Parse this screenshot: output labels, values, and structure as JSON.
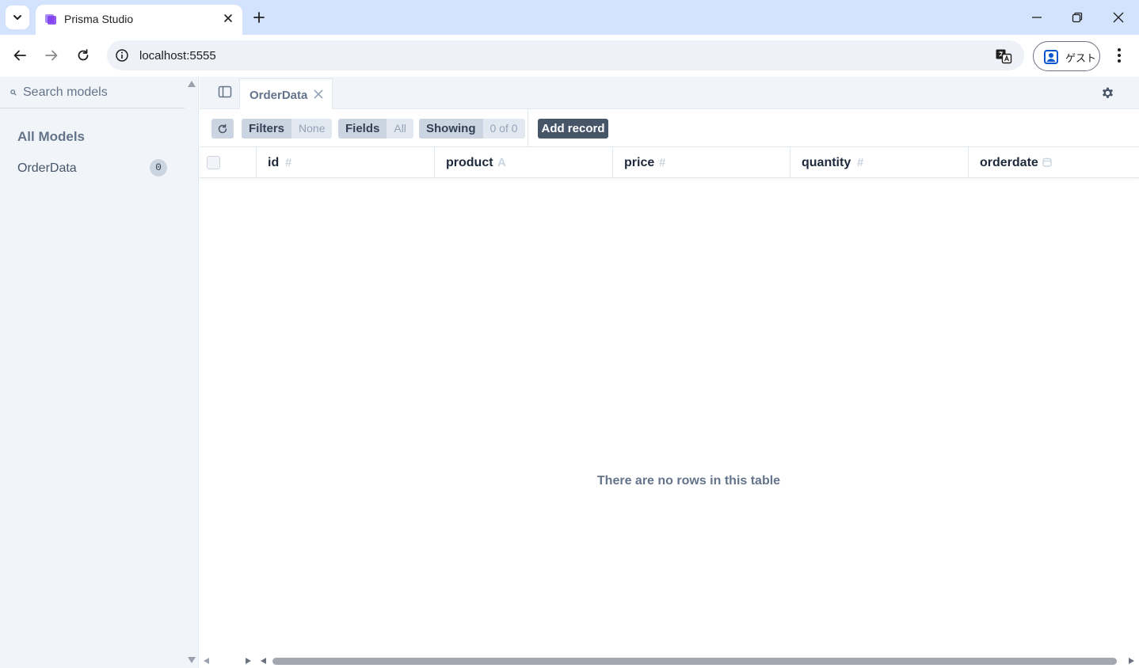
{
  "browser": {
    "tab_title": "Prisma Studio",
    "url": "localhost:5555",
    "profile_label": "ゲスト"
  },
  "sidebar": {
    "search_placeholder": "Search models",
    "heading": "All Models",
    "models": [
      {
        "name": "OrderData",
        "count": "0"
      }
    ]
  },
  "app_tab": {
    "label": "OrderData"
  },
  "actions": {
    "filters_label": "Filters",
    "filters_value": "None",
    "fields_label": "Fields",
    "fields_value": "All",
    "showing_label": "Showing",
    "showing_value": "0 of 0",
    "add_record_label": "Add record"
  },
  "table": {
    "columns": [
      {
        "name": "id",
        "type_glyph": "#"
      },
      {
        "name": "product",
        "type_glyph": "A"
      },
      {
        "name": "price",
        "type_glyph": "#"
      },
      {
        "name": "quantity",
        "type_glyph": "#"
      },
      {
        "name": "orderdate",
        "type_glyph": "calendar-icon"
      }
    ],
    "empty_message": "There are no rows in this table"
  }
}
